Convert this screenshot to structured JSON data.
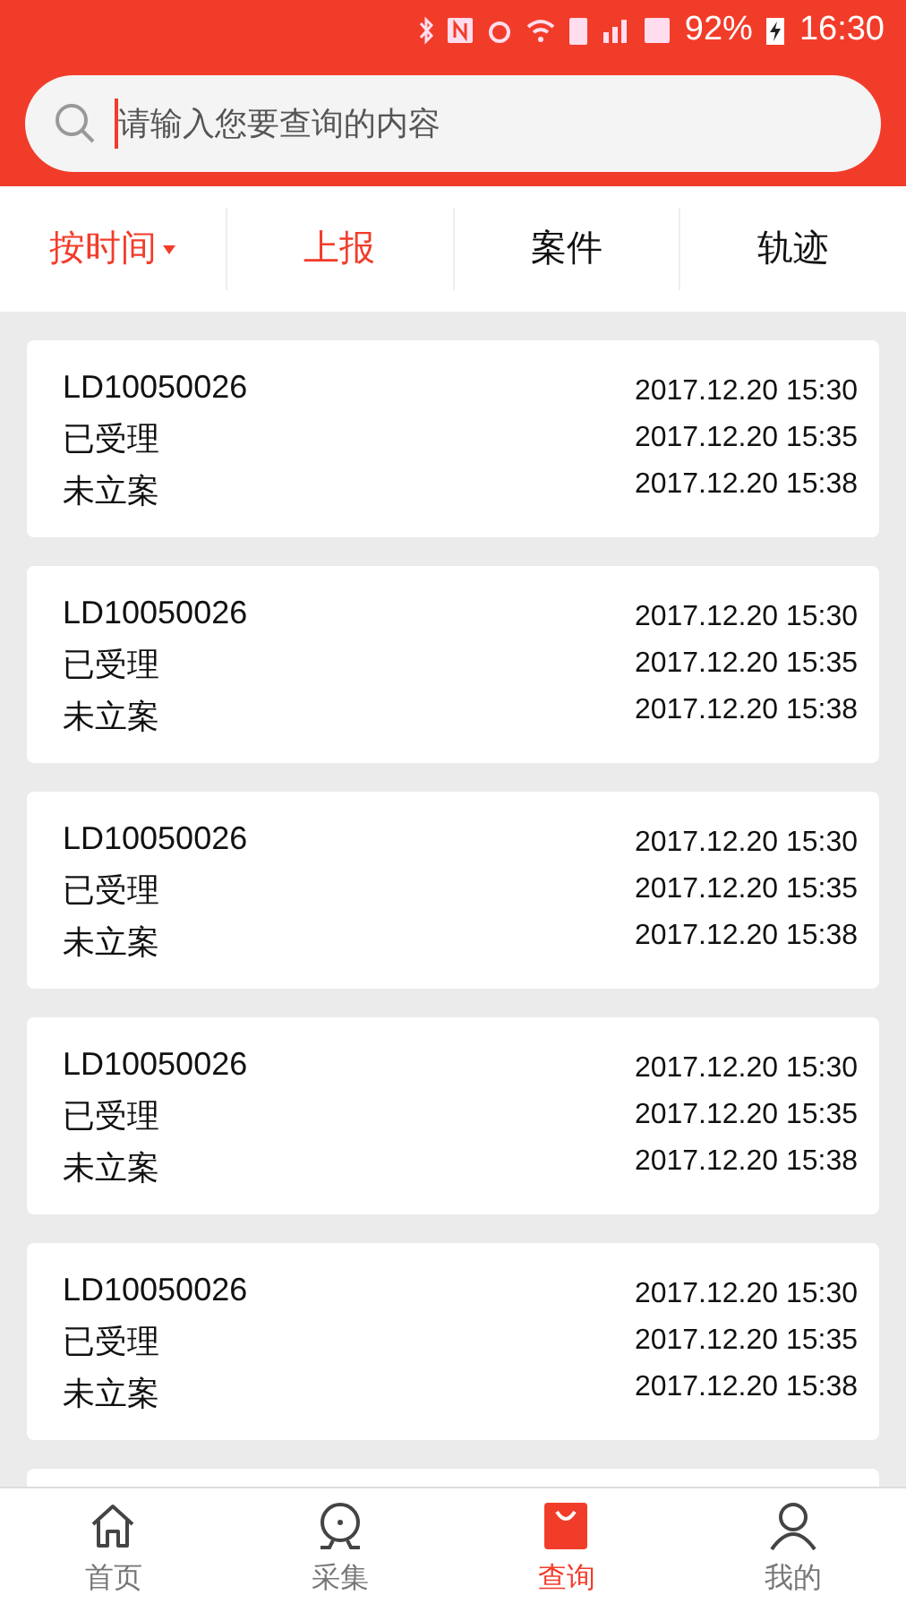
{
  "status_bar": {
    "battery": "92%",
    "time": "16:30"
  },
  "search": {
    "placeholder": "请输入您要查询的内容"
  },
  "filters": [
    {
      "label": "按时间",
      "kind": "dropdown",
      "selected": true
    },
    {
      "label": "上报",
      "kind": "tab",
      "selected": true
    },
    {
      "label": "案件",
      "kind": "tab",
      "selected": false
    },
    {
      "label": "轨迹",
      "kind": "tab",
      "selected": false
    }
  ],
  "records": [
    {
      "id": "LD10050026",
      "status": "已受理",
      "case_status": "未立案",
      "times": [
        "2017.12.20 15:30",
        "2017.12.20 15:35",
        "2017.12.20 15:38"
      ]
    },
    {
      "id": "LD10050026",
      "status": "已受理",
      "case_status": "未立案",
      "times": [
        "2017.12.20 15:30",
        "2017.12.20 15:35",
        "2017.12.20 15:38"
      ]
    },
    {
      "id": "LD10050026",
      "status": "已受理",
      "case_status": "未立案",
      "times": [
        "2017.12.20 15:30",
        "2017.12.20 15:35",
        "2017.12.20 15:38"
      ]
    },
    {
      "id": "LD10050026",
      "status": "已受理",
      "case_status": "未立案",
      "times": [
        "2017.12.20 15:30",
        "2017.12.20 15:35",
        "2017.12.20 15:38"
      ]
    },
    {
      "id": "LD10050026",
      "status": "已受理",
      "case_status": "未立案",
      "times": [
        "2017.12.20 15:30",
        "2017.12.20 15:35",
        "2017.12.20 15:38"
      ]
    }
  ],
  "bottom_nav": [
    {
      "label": "首页",
      "kind": "home",
      "selected": false
    },
    {
      "label": "采集",
      "kind": "collect",
      "selected": false
    },
    {
      "label": "查询",
      "kind": "query",
      "selected": true
    },
    {
      "label": "我的",
      "kind": "profile",
      "selected": false
    }
  ]
}
